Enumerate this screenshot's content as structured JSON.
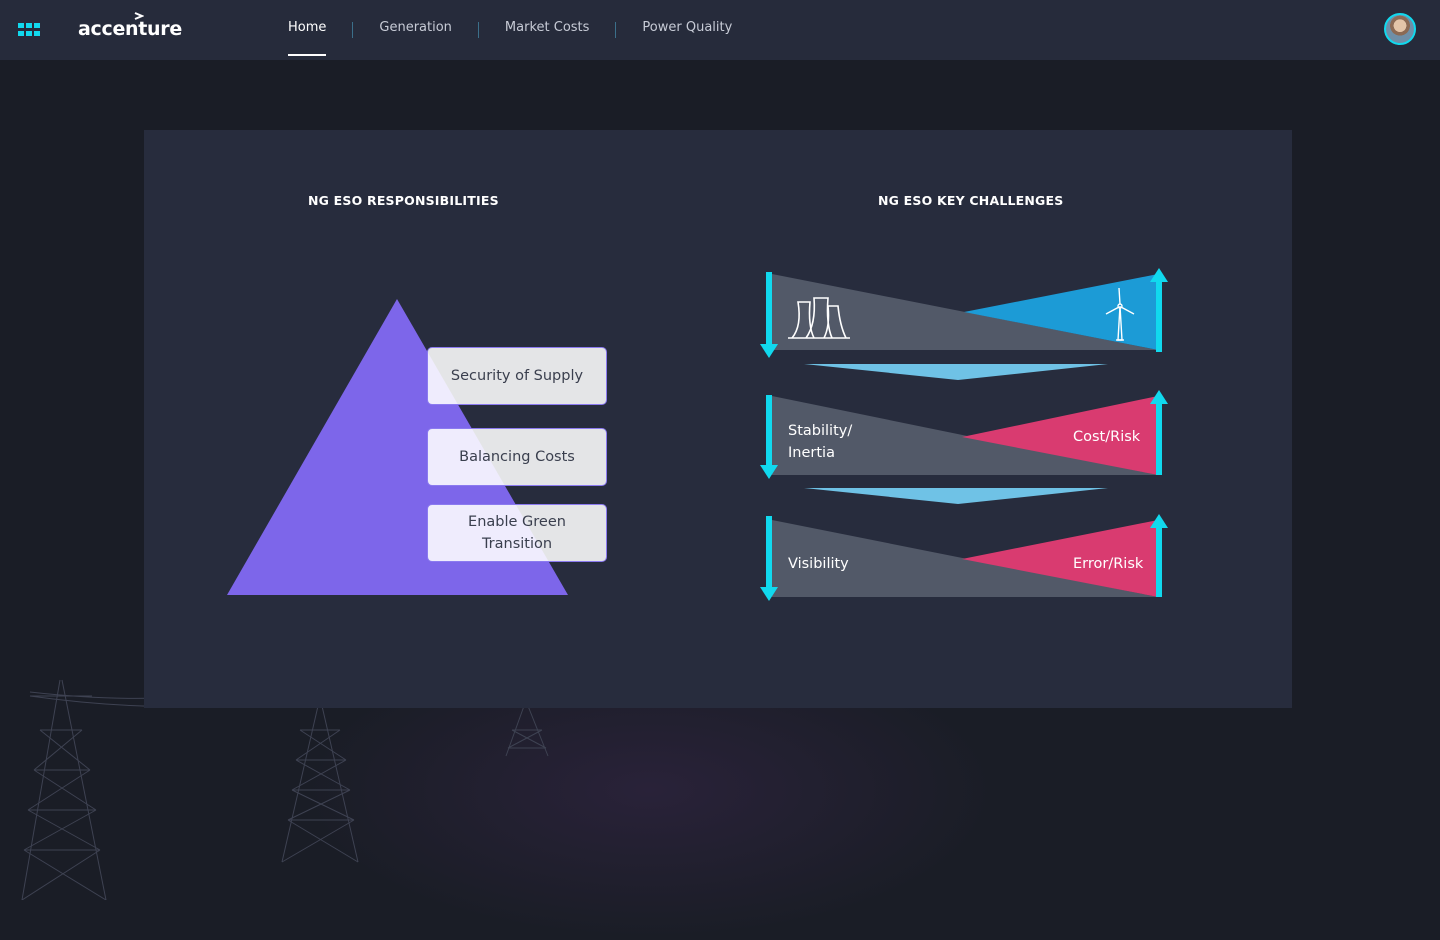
{
  "brand": {
    "name": "accenture"
  },
  "nav": {
    "items": [
      {
        "label": "Home",
        "active": true
      },
      {
        "label": "Generation",
        "active": false
      },
      {
        "label": "Market Costs",
        "active": false
      },
      {
        "label": "Power Quality",
        "active": false
      }
    ]
  },
  "responsibilities": {
    "title": "NG ESO RESPONSIBILITIES",
    "items": [
      "Security of Supply",
      "Balancing Costs",
      "Enable Green Transition"
    ]
  },
  "challenges": {
    "title": "NG ESO KEY CHALLENGES",
    "rows": [
      {
        "left_icon": "power-plant-icon",
        "right_icon": "wind-turbine-icon",
        "left_trend": "down",
        "right_trend": "up"
      },
      {
        "left_label": "Stability/ Inertia",
        "right_label": "Cost/Risk",
        "left_trend": "down",
        "right_trend": "up"
      },
      {
        "left_label": "Visibility",
        "right_label": "Error/Risk",
        "left_trend": "down",
        "right_trend": "up"
      }
    ]
  },
  "colors": {
    "accent": "#11d9ee",
    "pyramid": "#7d66ea",
    "renewable": "#1c9bd6",
    "risk": "#d93b70",
    "wedge_grey": "#525968",
    "connector": "#6fc2e6"
  }
}
